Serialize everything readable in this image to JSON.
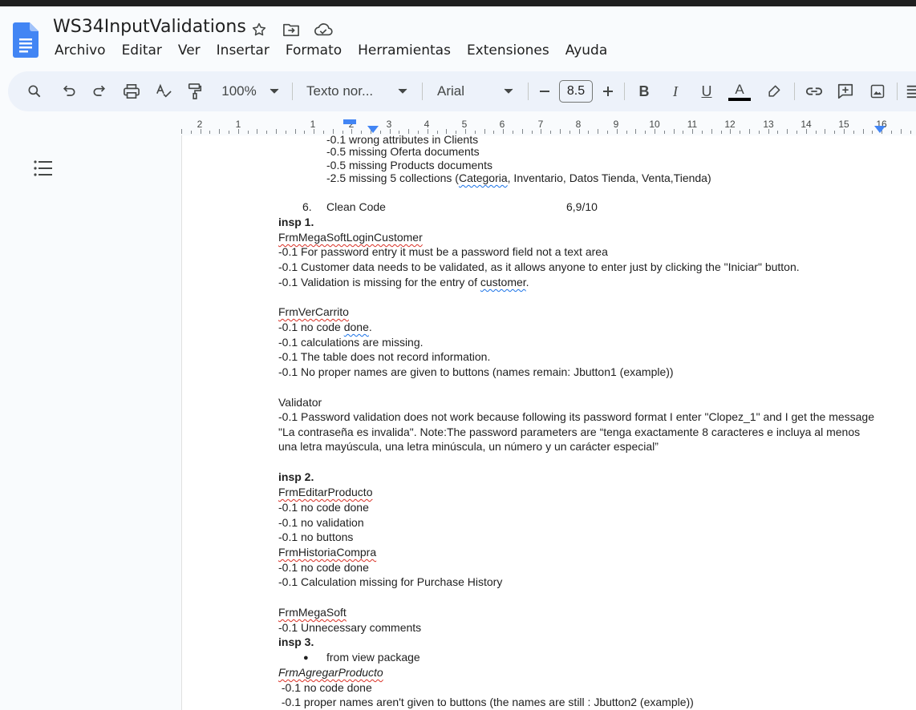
{
  "app": {
    "doc_title": "WS34InputValidations",
    "menu": [
      "Archivo",
      "Editar",
      "Ver",
      "Insertar",
      "Formato",
      "Herramientas",
      "Extensiones",
      "Ayuda"
    ],
    "icons": {
      "star": "star-icon",
      "move": "move-to-folder-icon",
      "cloud": "cloud-saved-icon"
    }
  },
  "toolbar": {
    "zoom": "100%",
    "style": "Texto nor...",
    "font": "Arial",
    "font_size": "8.5",
    "bold": "B",
    "italic": "I",
    "underline": "U",
    "text_color": "A"
  },
  "ruler": {
    "labels": [
      "2",
      "1",
      "1",
      "2",
      "3",
      "4",
      "5",
      "6",
      "7",
      "8",
      "9",
      "10",
      "11",
      "12",
      "13",
      "14",
      "15",
      "16"
    ]
  },
  "document": {
    "lines": [
      {
        "text": "-0.1 wrong attributes in Clients"
      },
      {
        "text": "-0.5 missing Oferta documents"
      },
      {
        "text": "-0.5 missing Products documents"
      },
      {
        "pre": "-2.5 missing 5 collections (",
        "mark": "Categoria",
        "post": ", Inventario, Datos Tienda, Venta,Tienda)"
      },
      {
        "num": "6.",
        "text": "Clean Code",
        "score": "6,9/10"
      },
      {
        "text": "insp 1."
      },
      {
        "text": "FrmMegaSoftLoginCustomer"
      },
      {
        "text": "-0.1 For password entry it must be a password field not a text area"
      },
      {
        "text": "-0.1 Customer data needs to be validated, as it allows anyone to enter just by clicking the \"Iniciar\" button."
      },
      {
        "pre": "-0.1  Validation is missing for the entry of ",
        "mark": "customer",
        "post": "."
      },
      {
        "text": "FrmVerCarrito"
      },
      {
        "pre": "-0.1 no code ",
        "mark": "done",
        "post": "."
      },
      {
        "text": "-0.1 calculations are missing."
      },
      {
        "text": "-0.1 The table does not record information."
      },
      {
        "text": "-0.1 No proper names are given to buttons (names remain: Jbutton1 (example))"
      },
      {
        "text": "Validator"
      },
      {
        "text": "-0.1 Password validation does not work because following its password format I enter \"Clopez_1\" and I get the message"
      },
      {
        "text": "\"La contraseña es invalida\". Note:The password parameters are “tenga exactamente 8 caracteres e incluya al menos"
      },
      {
        "text": "una letra mayúscula, una letra minúscula, un número y un carácter especial”"
      },
      {
        "text": "insp 2."
      },
      {
        "text": "FrmEditarProducto"
      },
      {
        "text": "-0.1 no code done"
      },
      {
        "text": "-0.1 no validation"
      },
      {
        "text": "-0.1 no buttons"
      },
      {
        "text": "FrmHistoriaCompra"
      },
      {
        "text": "-0.1 no code done"
      },
      {
        "text": "-0.1 Calculation missing for Purchase History"
      },
      {
        "text": "FrmMegaSoft"
      },
      {
        "text": "-0.1  Unnecessary comments"
      },
      {
        "text": "insp 3."
      },
      {
        "bullet": "●",
        "text": "from view package"
      },
      {
        "text": "FrmAgregarProducto"
      },
      {
        "text": " -0.1 no code done"
      },
      {
        "text": " -0.1 proper names aren't given to buttons (the names are still : Jbutton2 (example))"
      }
    ]
  }
}
